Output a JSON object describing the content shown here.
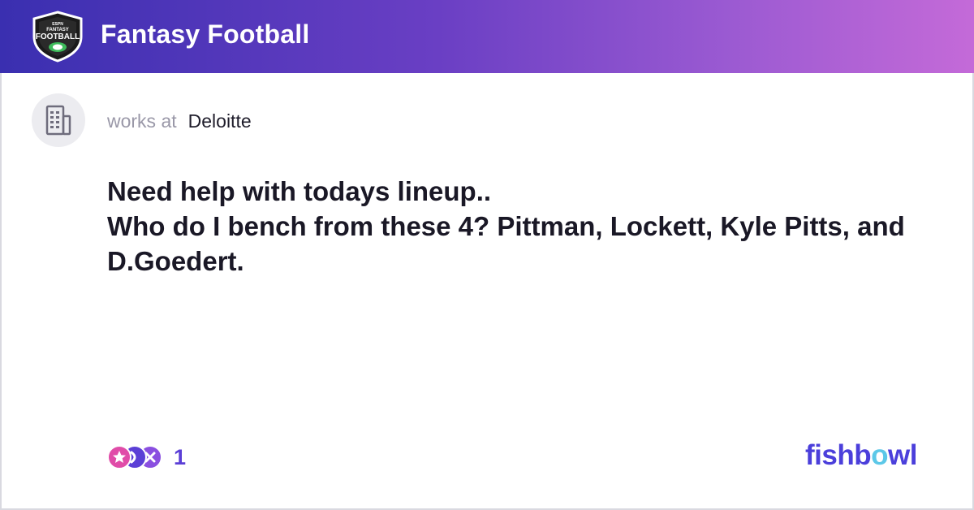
{
  "header": {
    "logo_text_top": "ESPN",
    "logo_text_mid": "FANTASY",
    "logo_text_main": "FOOTBALL",
    "community_name": "Fantasy Football"
  },
  "author": {
    "works_label": "works at",
    "company": "Deloitte",
    "avatar_icon": "building-icon"
  },
  "post": {
    "line1": "Need help with todays lineup..",
    "line2": "Who do I bench from these 4? Pittman, Lockett, Kyle Pitts, and D.Goedert."
  },
  "reactions": {
    "count": "1",
    "icons": [
      "star-reaction-icon",
      "clap-reaction-icon",
      "x-reaction-icon"
    ]
  },
  "brand": {
    "prefix": "fishb",
    "accent": "o",
    "suffix": "wl"
  },
  "colors": {
    "header_gradient_start": "#3a2fb0",
    "header_gradient_end": "#c46ad8",
    "brand": "#4b3fdb",
    "brand_accent": "#5cc8e8",
    "count": "#5b3fd6"
  }
}
